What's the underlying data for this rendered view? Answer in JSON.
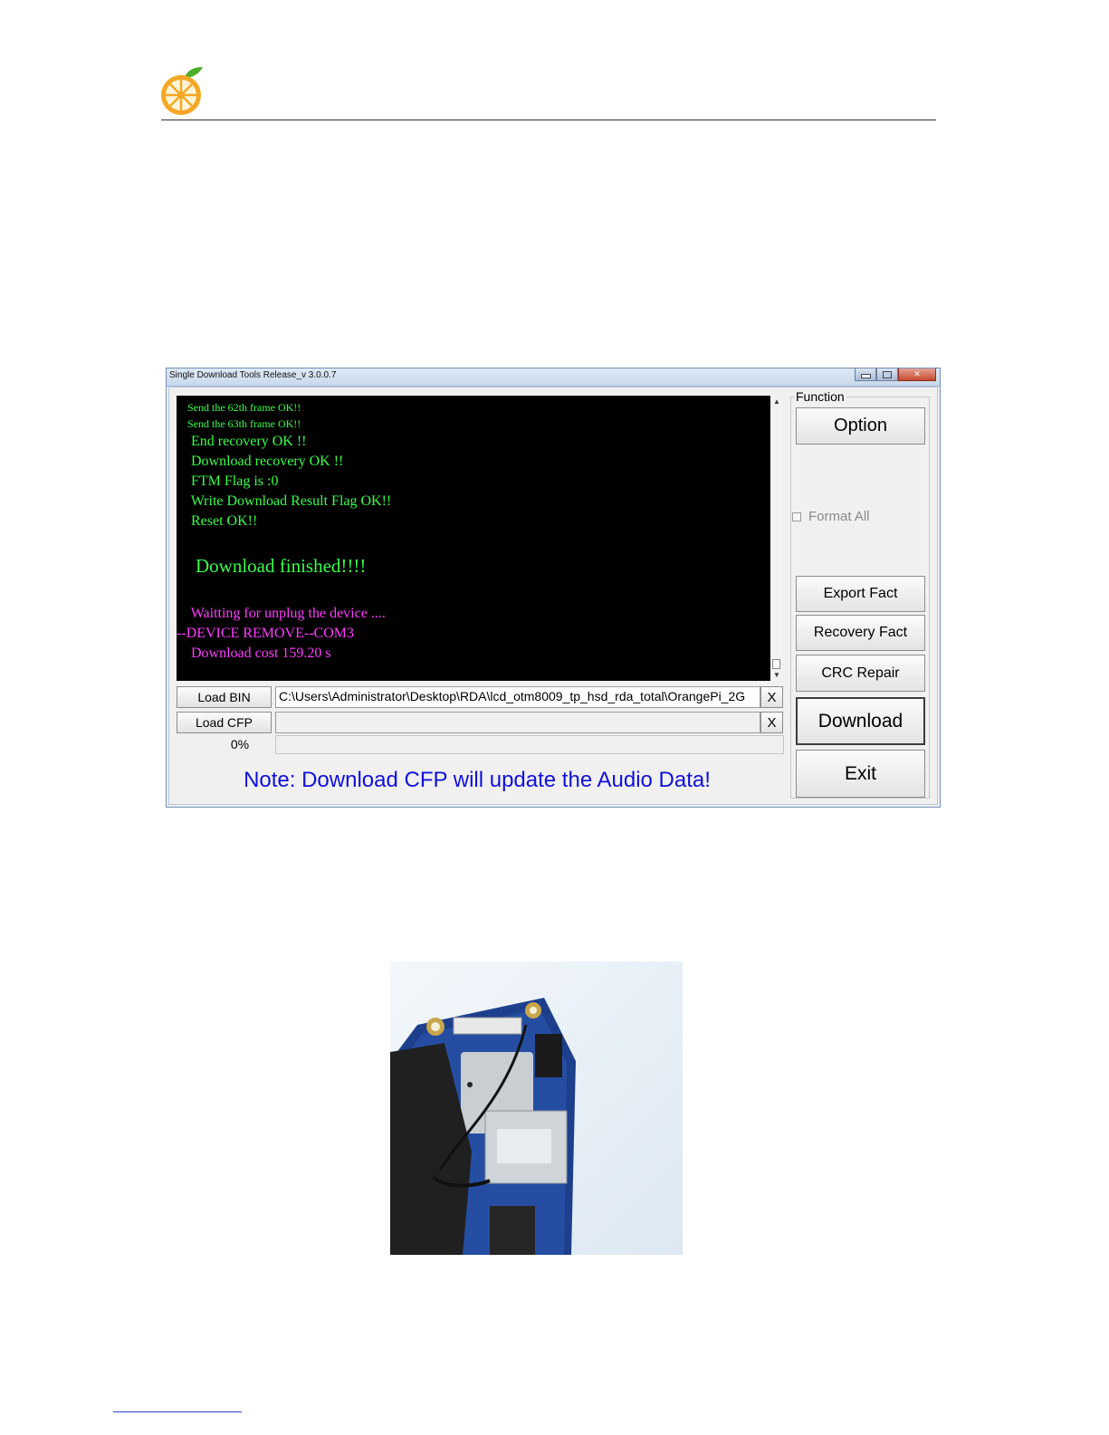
{
  "window": {
    "title": "Single Download Tools Release_v 3.0.0.7"
  },
  "console": {
    "lines": [
      {
        "text": "    Send the 62th frame OK!!",
        "color": "green",
        "size": "small"
      },
      {
        "text": "    Send the 63th frame OK!!",
        "color": "green",
        "size": "small"
      },
      {
        "text": "    End recovery OK !!",
        "color": "green",
        "size": "medium"
      },
      {
        "text": "    Download recovery OK !!",
        "color": "green",
        "size": "medium"
      },
      {
        "text": "    FTM Flag is :0",
        "color": "green",
        "size": "medium"
      },
      {
        "text": "    Write Download Result Flag OK!!",
        "color": "green",
        "size": "medium"
      },
      {
        "text": "    Reset OK!!",
        "color": "green",
        "size": "medium"
      },
      {
        "text": "    Download finished!!!!",
        "color": "green",
        "size": "large"
      },
      {
        "text": "    Waitting for unplug the device ....",
        "color": "magenta",
        "size": "medium"
      },
      {
        "text": "--DEVICE REMOVE--COM3",
        "color": "magenta",
        "size": "medium"
      },
      {
        "text": "    Download cost 159.20 s",
        "color": "magenta",
        "size": "medium"
      }
    ]
  },
  "load": {
    "bin_label": "Load BIN",
    "bin_path": "C:\\Users\\Administrator\\Desktop\\RDA\\lcd_otm8009_tp_hsd_rda_total\\OrangePi_2G",
    "bin_clear": "X",
    "cfp_label": "Load CFP",
    "cfp_path": "",
    "cfp_clear": "X"
  },
  "progress": {
    "percent_text": "0%",
    "value": 0
  },
  "note": "Note: Download CFP will update the Audio Data!",
  "function": {
    "group_title": "Function",
    "option": "Option",
    "format_all": "Format All",
    "format_all_checked": false,
    "export_fact": "Export Fact",
    "recovery_fact": "Recovery Fact",
    "crc_repair": "CRC Repair",
    "download": "Download",
    "exit": "Exit"
  },
  "colors": {
    "console_green": "#38ff48",
    "console_magenta": "#ff3cff",
    "note_blue": "#1010d8",
    "logo_orange": "#f5a623",
    "logo_leaf": "#4caf2a"
  },
  "icons": {
    "logo": "orange-slice-logo",
    "scroll_up": "scroll-up-arrow-icon",
    "scroll_down": "scroll-down-arrow-icon"
  }
}
